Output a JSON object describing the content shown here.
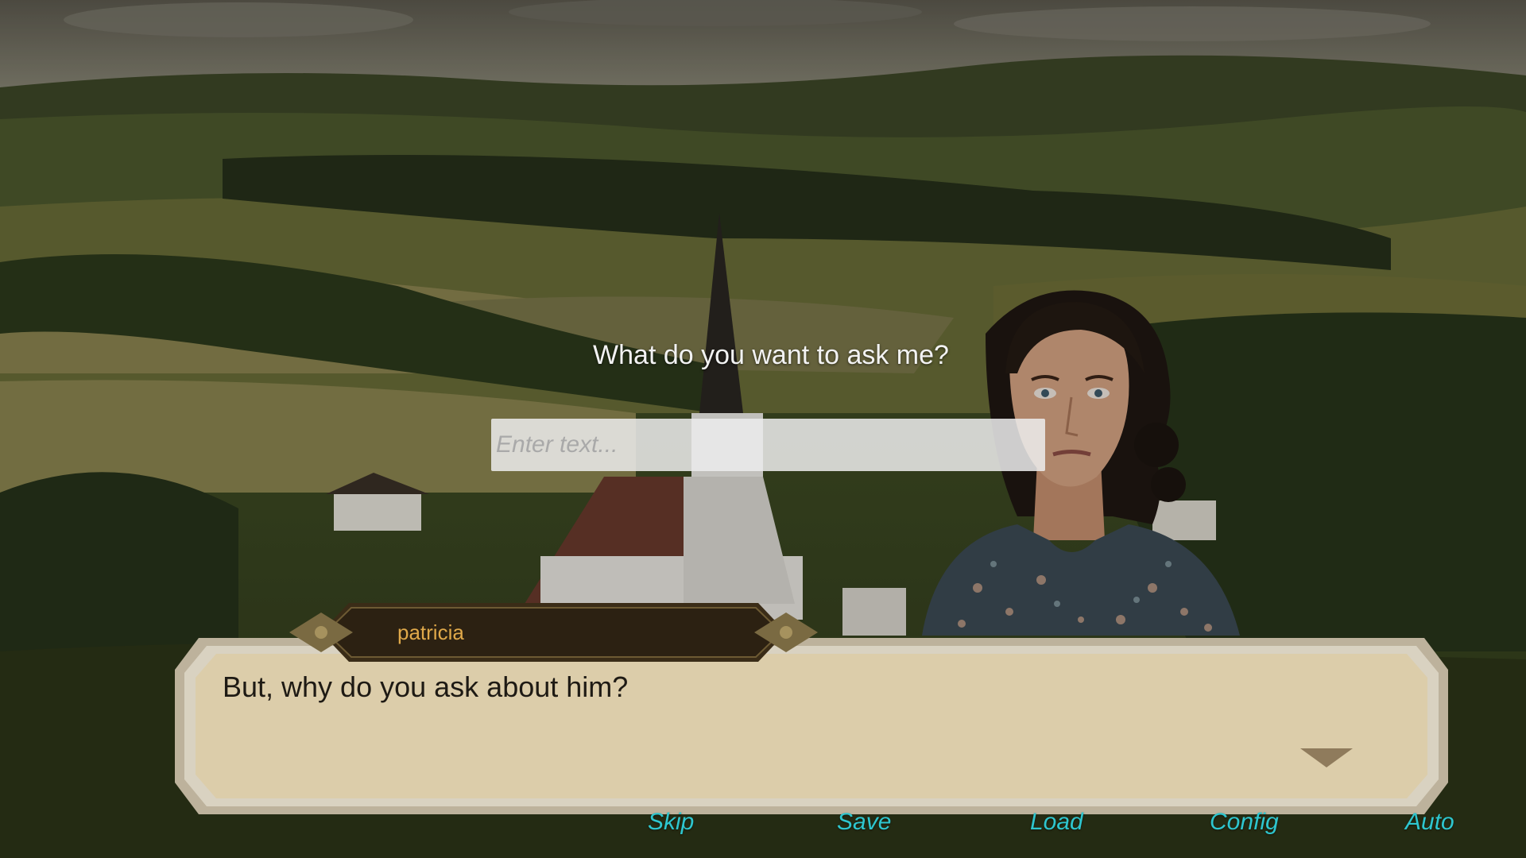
{
  "prompt": {
    "question": "What do you want to ask me?",
    "input_placeholder": "Enter text..."
  },
  "dialogue": {
    "speaker": "patricia",
    "line": "But, why do you ask about him?",
    "next_icon": "triangle-down-icon"
  },
  "menu": {
    "skip": "Skip",
    "save": "Save",
    "load": "Load",
    "config": "Config",
    "auto": "Auto"
  },
  "colors": {
    "menu_text": "#2ec6cf",
    "speaker_name": "#e0a94a",
    "dialog_parchment": "#dccdaa",
    "dialog_frame": "#cfc6b4"
  }
}
